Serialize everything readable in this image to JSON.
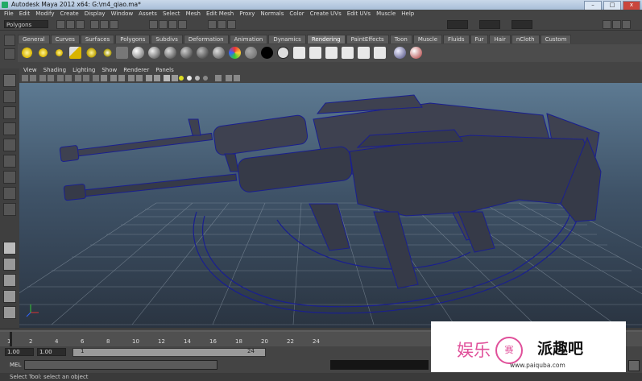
{
  "window": {
    "title": "Autodesk Maya 2012 x64: G:\\m4_qiao.ma*",
    "min": "–",
    "max": "□",
    "close": "x"
  },
  "menubar": [
    "File",
    "Edit",
    "Modify",
    "Create",
    "Display",
    "Window",
    "Assets",
    "Select",
    "Mesh",
    "Edit Mesh",
    "Proxy",
    "Normals",
    "Color",
    "Create UVs",
    "Edit UVs",
    "Muscle",
    "Help"
  ],
  "statusline": {
    "mode": "Polygons"
  },
  "shelf": {
    "tabs": [
      "General",
      "Curves",
      "Surfaces",
      "Polygons",
      "Subdivs",
      "Deformation",
      "Animation",
      "Dynamics",
      "Rendering",
      "PaintEffects",
      "Toon",
      "Muscle",
      "Fluids",
      "Fur",
      "Hair",
      "nCloth",
      "Custom"
    ],
    "active_tab": "Rendering"
  },
  "viewport": {
    "menus": [
      "View",
      "Shading",
      "Lighting",
      "Show",
      "Renderer",
      "Panels"
    ]
  },
  "timeslider": {
    "ticks": [
      "1",
      "2",
      "4",
      "6",
      "8",
      "10",
      "12",
      "14",
      "16",
      "18",
      "20",
      "22",
      "24"
    ]
  },
  "range": {
    "start": "1.00",
    "inner_start": "1.00",
    "slider_label": "1",
    "end_label": "24"
  },
  "cmdline": {
    "label": "MEL"
  },
  "helpline": {
    "text": "Select Tool: select an object"
  },
  "watermark": {
    "logo_left": "娱乐",
    "logo_circle": "赛",
    "site_name": "派趣吧",
    "site_url": "www.paiquba.com"
  },
  "colors": {
    "accent": "#8fa0ff",
    "wireframe": "#1a1f8f",
    "grid": "#9aa7b4"
  }
}
